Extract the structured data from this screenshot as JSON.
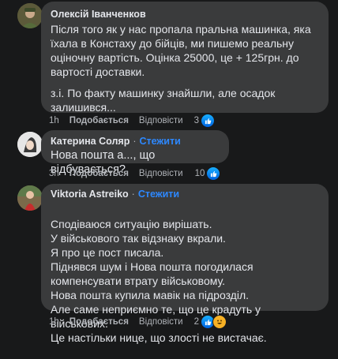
{
  "comments": [
    {
      "author": "Олексій Іванченков",
      "follow": "",
      "paragraphs": [
        "Після того як у нас пропала пральна машинка, яка їхала в Констаху до бійців, ми пишемо реальну оціночну вартість. Оцінка 25000, це + 125грн. до вартості доставки.",
        "з.і. По факту машинку знайшли, але осадок залишився..."
      ],
      "time": "1h",
      "like_label": "Подобається",
      "reply_label": "Відповісти",
      "reaction_count": "3"
    },
    {
      "author": "Катерина Соляр",
      "follow": "Стежити",
      "paragraphs": [
        "Нова пошта а..., що відбувається?"
      ],
      "time": "3h",
      "like_label": "Подобається",
      "reply_label": "Відповісти",
      "reaction_count": "10"
    },
    {
      "author": "Viktoria Astreiko",
      "follow": "Стежити",
      "paragraphs": [
        "Сподіваюся ситуацію вирішать.\nУ військового так відзнаку вкрали.\nЯ про це пост писала.\nПіднявся шум і Нова пошта погодилася компенсувати втрату військовому.\nНова пошта купила мавік на підрозділ.\nАле саме неприємно те, що це крадуть у військових.\nЦе настільки нице, що злості не вистачає."
      ],
      "time": "1h",
      "like_label": "Подобається",
      "reply_label": "Відповісти",
      "reaction_count": "2"
    }
  ],
  "separator": "·",
  "colors": {
    "background": "#18191a",
    "bubble": "#3a3b3c",
    "link": "#2d88ff",
    "meta": "#b0b3b8"
  },
  "icons": {
    "like": "like-icon",
    "haha": "haha-icon"
  }
}
